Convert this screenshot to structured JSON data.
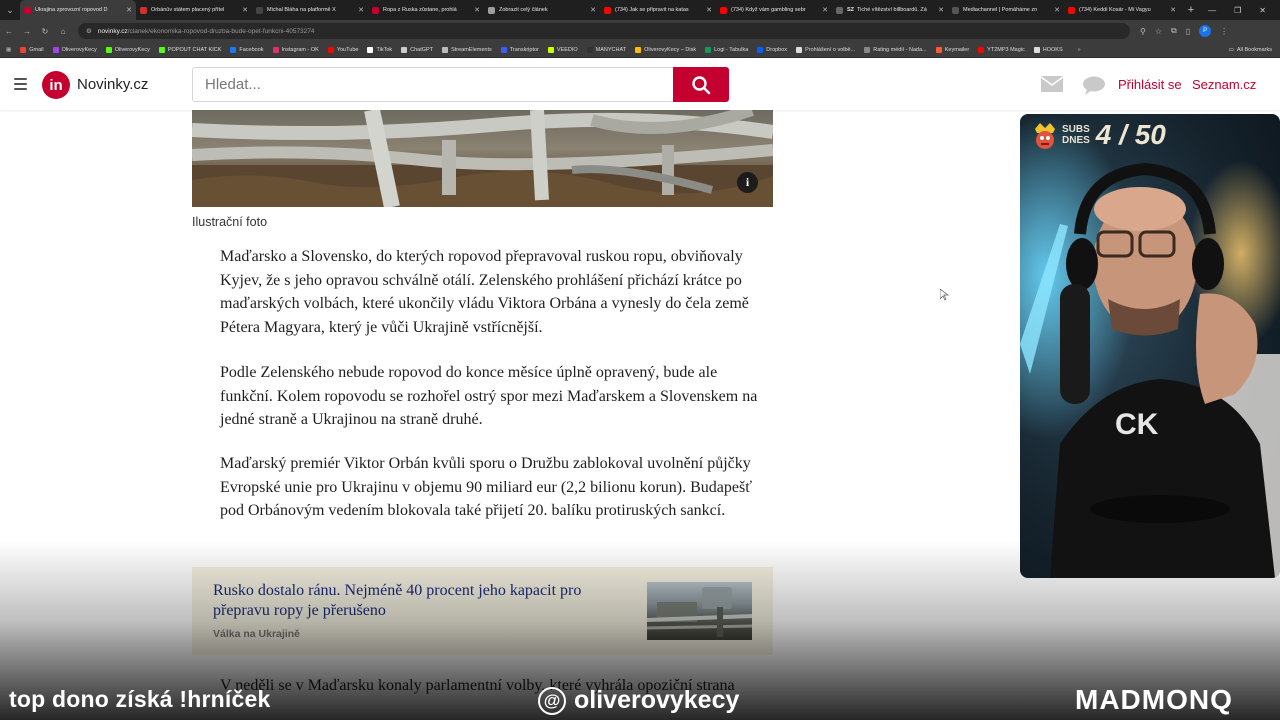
{
  "browser": {
    "tabs": [
      {
        "title": "Ukrajina zprovozní ropovod D",
        "color": "#c3002f",
        "active": true
      },
      {
        "title": "Orbánův státem placený přítel",
        "color": "#d32f2f"
      },
      {
        "title": "Michal Bláha na platformě X",
        "color": "#444444"
      },
      {
        "title": "Ropa z Ruska zůstane, prohlá",
        "color": "#c3002f"
      },
      {
        "title": "Zobrazit celý článek",
        "color": "#9e9e9e"
      },
      {
        "title": "(734) Jak se připravit na katas",
        "color": "#ff0000"
      },
      {
        "title": "(734) Když vám gambling sebr",
        "color": "#ff0000"
      },
      {
        "title": "Tiché vítězství billboardů. Zá",
        "color": "#666666",
        "badge": "SZ"
      },
      {
        "title": "Mediachannel | Pomáháme zn",
        "color": "#555555"
      },
      {
        "title": "(734) Keddi Kosár - Mi Vagyu",
        "color": "#ff0000"
      }
    ],
    "new_tab": "+",
    "url": {
      "domain": "novinky.cz",
      "path": "/clanek/ekonomika-ropovod-druzba-bude-opet-funkcni-40573274"
    },
    "bookmarks": [
      {
        "label": "Gmail",
        "color": "#ea4335"
      },
      {
        "label": "OliverovyKecy",
        "color": "#a142f4"
      },
      {
        "label": "OliverovyKecy",
        "color": "#53fc18"
      },
      {
        "label": "POPOUT CHAT KICK",
        "color": "#53fc18"
      },
      {
        "label": "Facebook",
        "color": "#1877f2"
      },
      {
        "label": "Instagram - OK",
        "color": "#e1306c"
      },
      {
        "label": "YouTube",
        "color": "#ff0000"
      },
      {
        "label": "TikTok",
        "color": "#ffffff"
      },
      {
        "label": "ChatGPT",
        "color": "#cccccc"
      },
      {
        "label": "StreamElements",
        "color": "#bbbbbb"
      },
      {
        "label": "Transkriptor",
        "color": "#3d5afe"
      },
      {
        "label": "VEEDIO",
        "color": "#c6ff00"
      },
      {
        "label": "MANYCHAT",
        "color": "#333333"
      },
      {
        "label": "OliverovyKecy – Disk",
        "color": "#fbbc04"
      },
      {
        "label": "Logi - Tabulka",
        "color": "#0f9d58"
      },
      {
        "label": "Dropbox",
        "color": "#0061fe"
      },
      {
        "label": "Prohlášení o volbě...",
        "color": "#dddddd"
      },
      {
        "label": "Rating médií - Nada...",
        "color": "#888888"
      },
      {
        "label": "Keymailer",
        "color": "#ff5a36"
      },
      {
        "label": "YT2MP3 Magic",
        "color": "#ff0000"
      },
      {
        "label": "HOOKS",
        "color": "#dddddd"
      }
    ],
    "all_bookmarks": "All Bookmarks"
  },
  "site": {
    "logo_badge": "in",
    "logo_text": "Novinky.cz",
    "search_placeholder": "Hledat...",
    "login": "Přihlásit se",
    "seznam": "Seznam.cz",
    "brand_color": "#c3002f"
  },
  "article": {
    "caption": "Ilustrační foto",
    "paragraphs": [
      "Maďarsko a Slovensko, do kterých ropovod přepravoval ruskou ropu, obviňovaly Kyjev, že s jeho opravou schválně otálí. Zelenského prohlášení přichází krátce po maďarských volbách, které ukončily vládu Viktora Orbána a vynesly do čela země Pétera Magyara, který je vůči Ukrajině vstřícnější.",
      "Podle Zelenského nebude ropovod do konce měsíce úplně opravený, bude ale funkční. Kolem ropovodu se rozhořel ostrý spor mezi Maďarskem a Slovenskem na jedné straně a Ukrajinou na straně druhé.",
      "Maďarský premiér Viktor Orbán kvůli sporu o Družbu zablokoval uvolnění půjčky Evropské unie pro Ukrajinu v objemu 90 miliard eur (2,2 bilionu korun). Budapešť pod Orbánovým vedením blokovala také přijetí 20. balíku protiruských sankcí."
    ],
    "related": {
      "title": "Rusko dostalo ránu. Nejméně 40 procent jeho kapacit pro přepravu ropy je přerušeno",
      "tag": "Válka na Ukrajině"
    },
    "next_paragraph": "V neděli se v Maďarsku konaly parlamentní volby, které vyhrála opoziční strana"
  },
  "stream": {
    "subs_label_line1": "SUBS",
    "subs_label_line2": "DNES",
    "subs_count": "4 / 50",
    "overlay_left": "top dono získá !hrníček",
    "overlay_center": "oliverovykecy",
    "overlay_right": "MADMONQ"
  }
}
